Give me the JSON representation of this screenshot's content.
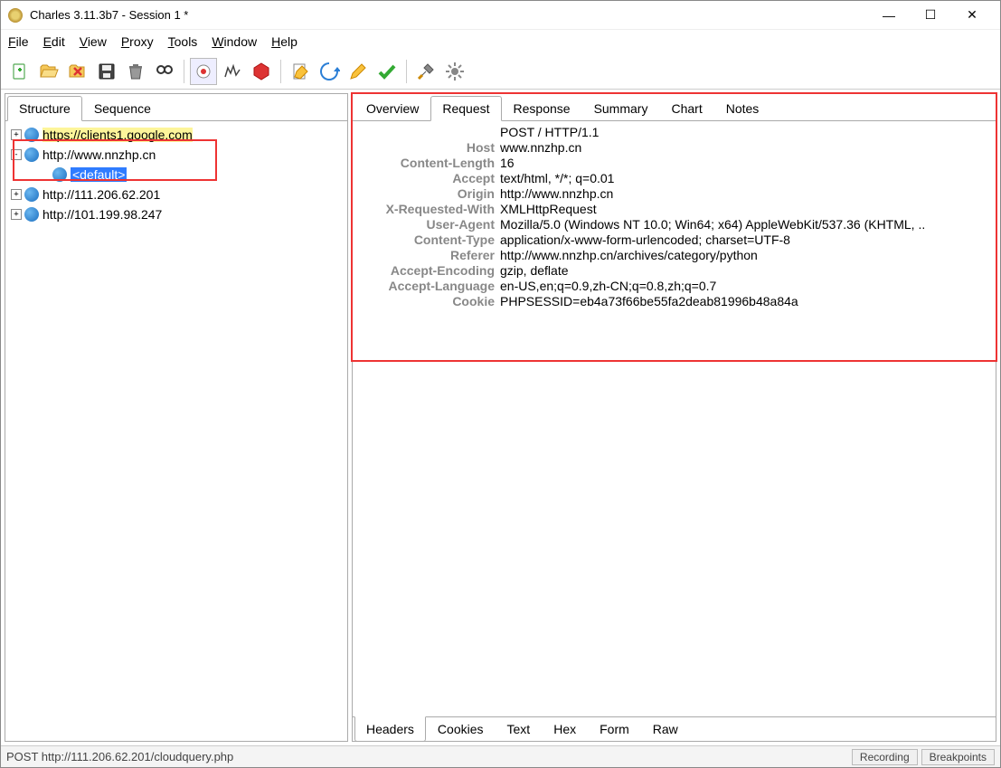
{
  "window": {
    "title": "Charles 3.11.3b7 - Session 1 *"
  },
  "menu": {
    "file": "File",
    "edit": "Edit",
    "view": "View",
    "proxy": "Proxy",
    "tools": "Tools",
    "window": "Window",
    "help": "Help"
  },
  "left_tabs": {
    "structure": "Structure",
    "sequence": "Sequence"
  },
  "tree": {
    "items": [
      {
        "label": "https://clients1.google.com",
        "expanded": false,
        "highlight": "yellow"
      },
      {
        "label": "http://www.nnzhp.cn",
        "expanded": true
      },
      {
        "label": "<default>",
        "child_of": 1,
        "highlight": "blue"
      },
      {
        "label": "http://111.206.62.201",
        "expanded": false
      },
      {
        "label": "http://101.199.98.247",
        "expanded": false
      }
    ]
  },
  "right_tabs": {
    "overview": "Overview",
    "request": "Request",
    "response": "Response",
    "summary": "Summary",
    "chart": "Chart",
    "notes": "Notes"
  },
  "request": {
    "line": "POST / HTTP/1.1",
    "headers": [
      {
        "key": "Host",
        "value": "www.nnzhp.cn"
      },
      {
        "key": "Content-Length",
        "value": "16"
      },
      {
        "key": "Accept",
        "value": "text/html, */*; q=0.01"
      },
      {
        "key": "Origin",
        "value": "http://www.nnzhp.cn"
      },
      {
        "key": "X-Requested-With",
        "value": "XMLHttpRequest"
      },
      {
        "key": "User-Agent",
        "value": "Mozilla/5.0 (Windows NT 10.0; Win64; x64) AppleWebKit/537.36 (KHTML, .."
      },
      {
        "key": "Content-Type",
        "value": "application/x-www-form-urlencoded; charset=UTF-8"
      },
      {
        "key": "Referer",
        "value": "http://www.nnzhp.cn/archives/category/python"
      },
      {
        "key": "Accept-Encoding",
        "value": "gzip, deflate"
      },
      {
        "key": "Accept-Language",
        "value": "en-US,en;q=0.9,zh-CN;q=0.8,zh;q=0.7"
      },
      {
        "key": "Cookie",
        "value": "PHPSESSID=eb4a73f66be55fa2deab81996b48a84a"
      }
    ]
  },
  "bottom_tabs": {
    "headers": "Headers",
    "cookies": "Cookies",
    "text": "Text",
    "hex": "Hex",
    "form": "Form",
    "raw": "Raw"
  },
  "status": {
    "left": "POST http://111.206.62.201/cloudquery.php",
    "recording": "Recording",
    "breakpoints": "Breakpoints"
  }
}
